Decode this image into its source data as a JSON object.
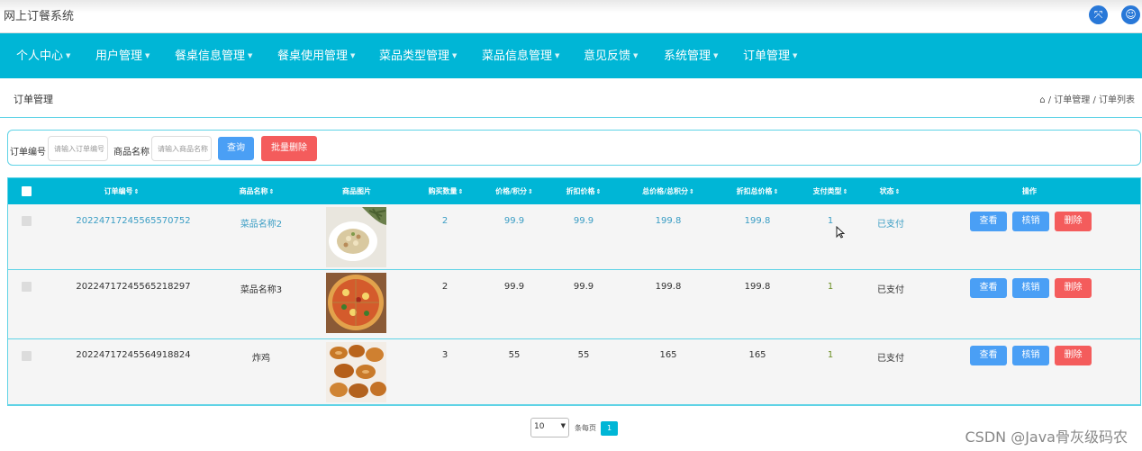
{
  "app": {
    "title": "网上订餐系统"
  },
  "titlebar_icons": [
    {
      "name": "fullscreen-icon",
      "glyph": "⤧"
    },
    {
      "name": "user-icon",
      "glyph": "☺"
    }
  ],
  "nav": [
    "个人中心",
    "用户管理",
    "餐桌信息管理",
    "餐桌使用管理",
    "菜品类型管理",
    "菜品信息管理",
    "意见反馈",
    "系统管理",
    "订单管理"
  ],
  "breadcrumb": {
    "section": "订单管理",
    "path": "⌂ / 订单管理 / 订单列表"
  },
  "search": {
    "order_label": "订单编号",
    "order_placeholder": "请输入订单编号",
    "name_label": "商品名称",
    "name_placeholder": "请输入商品名称",
    "query_button": "查询",
    "batch_delete_button": "批量删除"
  },
  "table": {
    "headers": [
      "订单编号",
      "商品名称",
      "商品图片",
      "购买数量",
      "价格/积分",
      "折扣价格",
      "总价格/总积分",
      "折扣总价格",
      "支付类型",
      "状态",
      "操作"
    ],
    "sortable": [
      true,
      true,
      false,
      true,
      true,
      true,
      true,
      true,
      true,
      true,
      false
    ],
    "rows": [
      {
        "order_no": "20224717245565570752",
        "name": "菜品名称2",
        "image": "soup",
        "qty": "2",
        "price": "99.9",
        "discount": "99.9",
        "total": "199.8",
        "discount_total": "199.8",
        "pay_type": "1",
        "status": "已支付",
        "highlighted": true
      },
      {
        "order_no": "20224717245565218297",
        "name": "菜品名称3",
        "image": "pizza",
        "qty": "2",
        "price": "99.9",
        "discount": "99.9",
        "total": "199.8",
        "discount_total": "199.8",
        "pay_type": "1",
        "status": "已支付",
        "highlighted": false
      },
      {
        "order_no": "20224717245564918824",
        "name": "炸鸡",
        "image": "chicken",
        "qty": "3",
        "price": "55",
        "discount": "55",
        "total": "165",
        "discount_total": "165",
        "pay_type": "1",
        "status": "已支付",
        "highlighted": false
      }
    ],
    "actions": {
      "view": "查看",
      "edit": "核销",
      "delete": "删除"
    }
  },
  "pager": {
    "page_size": "10",
    "suffix": "条每页",
    "current_page": "1"
  },
  "watermark": "CSDN @Java骨灰级码农",
  "colors": {
    "primary": "#00b6d6",
    "button_blue": "#4a9ff5",
    "button_red": "#f45c5c",
    "link": "#3a9dc4"
  }
}
